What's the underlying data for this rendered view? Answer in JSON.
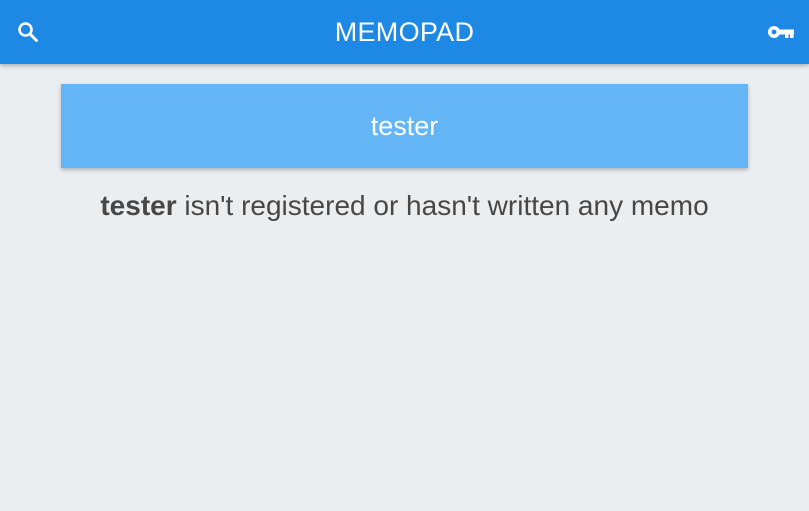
{
  "header": {
    "title": "MEMOPAD",
    "left_icon": "search-icon",
    "right_icon": "key-icon",
    "color": "#1e88e5"
  },
  "user_banner": {
    "username": "tester",
    "color": "#64b5f6"
  },
  "message": {
    "username": "tester",
    "text": " isn't registered or hasn't written any memo"
  },
  "background_color": "#eaeef1"
}
